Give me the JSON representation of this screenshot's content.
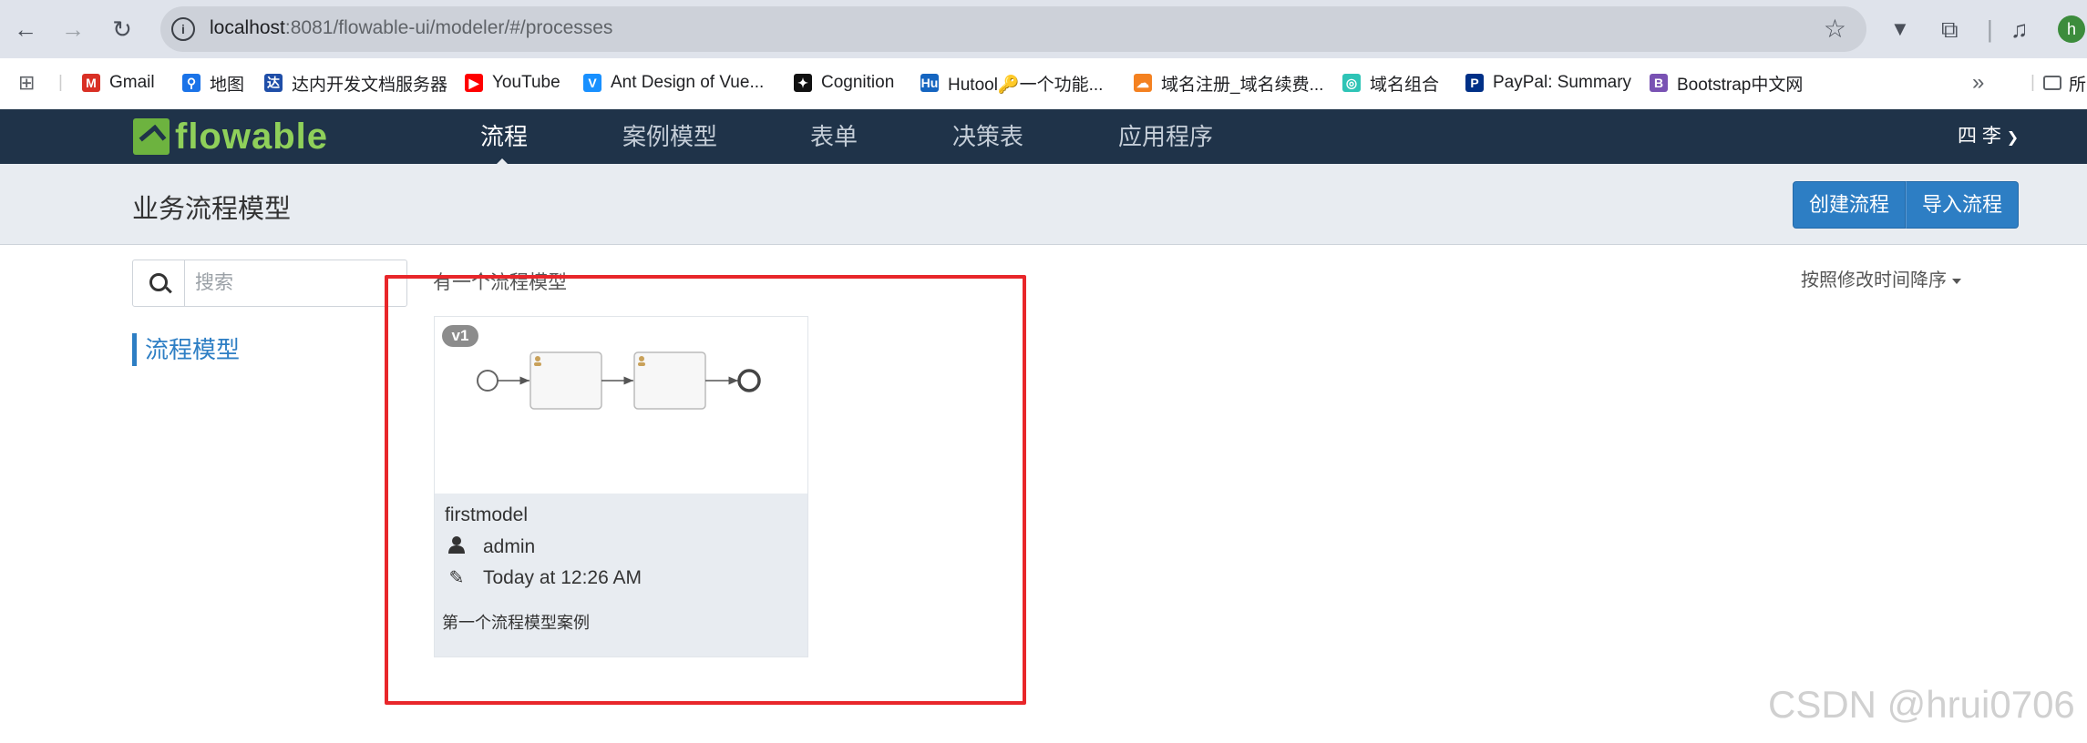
{
  "browser": {
    "url_host": "localhost",
    "url_rest": ":8081/flowable-ui/modeler/#/processes",
    "profile_initial": "h",
    "bookmarks": [
      {
        "label": "Gmail",
        "icon": "gmail-icon",
        "color": "#d93025"
      },
      {
        "label": "地图",
        "icon": "maps-pin-icon",
        "color": "#1a73e8"
      },
      {
        "label": "达内开发文档服务器",
        "icon": "tarena-icon",
        "color": "#1f4ea8"
      },
      {
        "label": "YouTube",
        "icon": "youtube-icon",
        "color": "#ff0000"
      },
      {
        "label": "Ant Design of Vue...",
        "icon": "antdv-icon",
        "color": "#1890ff"
      },
      {
        "label": "Cognition",
        "icon": "cognition-icon",
        "color": "#111111"
      },
      {
        "label": "Hutool🔑一个功能...",
        "icon": "hutool-icon",
        "color": "#1565c0"
      },
      {
        "label": "域名注册_域名续费...",
        "icon": "cloudflare-icon",
        "color": "#f48120"
      },
      {
        "label": "域名组合",
        "icon": "spiral-icon",
        "color": "#2ec4b6"
      },
      {
        "label": "PayPal: Summary",
        "icon": "paypal-icon",
        "color": "#003087"
      },
      {
        "label": "Bootstrap中文网",
        "icon": "bootstrap-icon",
        "color": "#7952b3"
      }
    ],
    "more_label": "»",
    "all_bookmarks_label": "所"
  },
  "app": {
    "logo_text": "flowable",
    "tabs": [
      {
        "label": "流程",
        "active": true
      },
      {
        "label": "案例模型",
        "active": false
      },
      {
        "label": "表单",
        "active": false
      },
      {
        "label": "决策表",
        "active": false
      },
      {
        "label": "应用程序",
        "active": false
      }
    ],
    "user_label": "四 李",
    "page_title": "业务流程模型",
    "create_button": "创建流程",
    "import_button": "导入流程",
    "search_placeholder": "搜索",
    "sidebar_item": "流程模型",
    "count_text": "有一个流程模型",
    "sort_label": "按照修改时间降序",
    "models": [
      {
        "version": "v1",
        "name": "firstmodel",
        "owner": "admin",
        "modified": "Today at 12:26 AM",
        "description": "第一个流程模型案例"
      }
    ]
  },
  "watermark": "CSDN @hrui0706",
  "colors": {
    "nav_bg": "#1f3349",
    "accent": "#2d7ec4",
    "highlight": "#e8262a",
    "logo_green": "#8fd05a"
  }
}
